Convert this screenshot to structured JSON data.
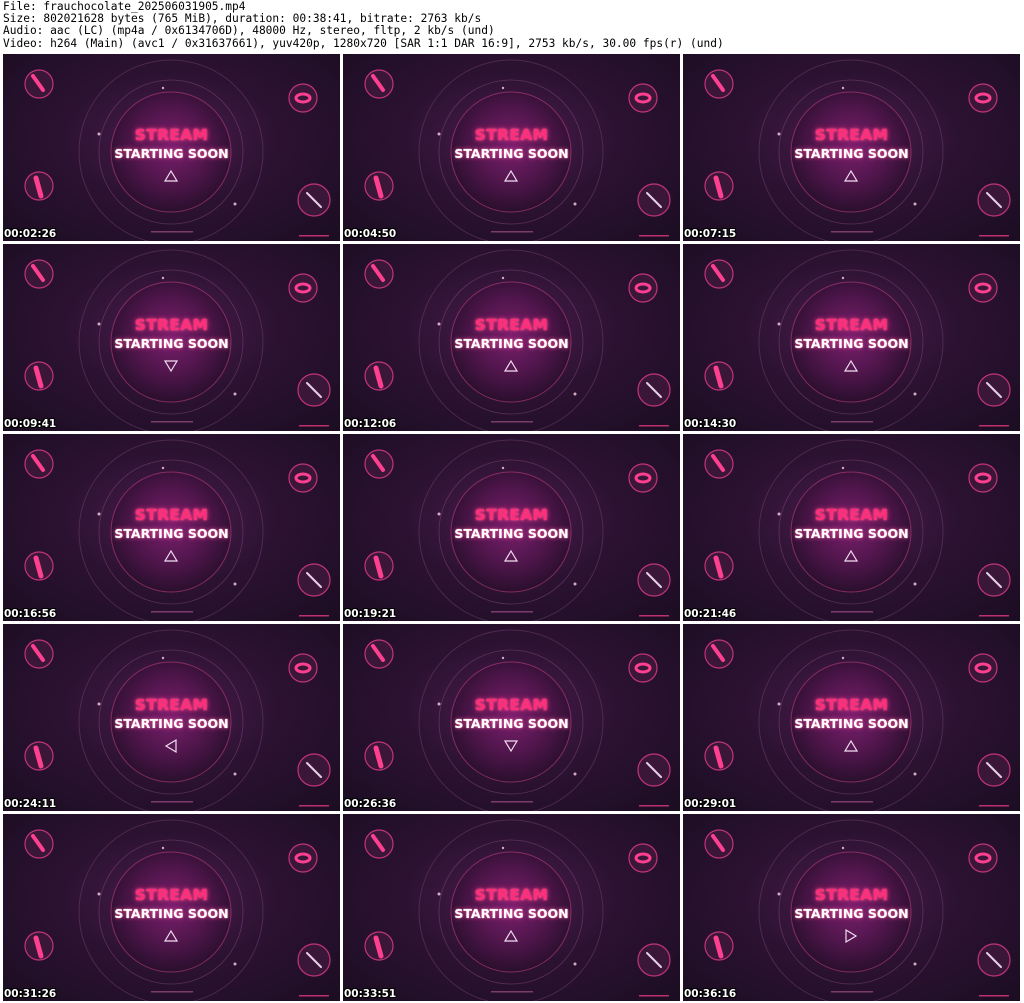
{
  "header": {
    "file_line": "File: frauchocolate_202506031905.mp4",
    "size_line": "Size: 802021628 bytes (765 MiB), duration: 00:38:41, bitrate: 2763 kb/s",
    "audio_line": "Audio: aac (LC) (mp4a / 0x6134706D), 48000 Hz, stereo, fltp, 2 kb/s (und)",
    "video_line": "Video: h264 (Main) (avc1 / 0x31637661), yuv420p, 1280x720 [SAR 1:1 DAR 16:9], 2753 kb/s, 30.00 fps(r) (und)"
  },
  "frame_text": {
    "line1": "STREAM",
    "line2": "STARTING SOON"
  },
  "colors": {
    "accent_pink": "#ff2e7a",
    "background_purple": "#2c1232",
    "timestamp_text": "#ffffff"
  },
  "frames": [
    {
      "timestamp": "00:02:26",
      "triangle": "up"
    },
    {
      "timestamp": "00:04:50",
      "triangle": "up"
    },
    {
      "timestamp": "00:07:15",
      "triangle": "up"
    },
    {
      "timestamp": "00:09:41",
      "triangle": "down"
    },
    {
      "timestamp": "00:12:06",
      "triangle": "up"
    },
    {
      "timestamp": "00:14:30",
      "triangle": "up"
    },
    {
      "timestamp": "00:16:56",
      "triangle": "up"
    },
    {
      "timestamp": "00:19:21",
      "triangle": "up"
    },
    {
      "timestamp": "00:21:46",
      "triangle": "up"
    },
    {
      "timestamp": "00:24:11",
      "triangle": "left"
    },
    {
      "timestamp": "00:26:36",
      "triangle": "down"
    },
    {
      "timestamp": "00:29:01",
      "triangle": "up"
    },
    {
      "timestamp": "00:31:26",
      "triangle": "up"
    },
    {
      "timestamp": "00:33:51",
      "triangle": "up"
    },
    {
      "timestamp": "00:36:16",
      "triangle": "right"
    }
  ]
}
